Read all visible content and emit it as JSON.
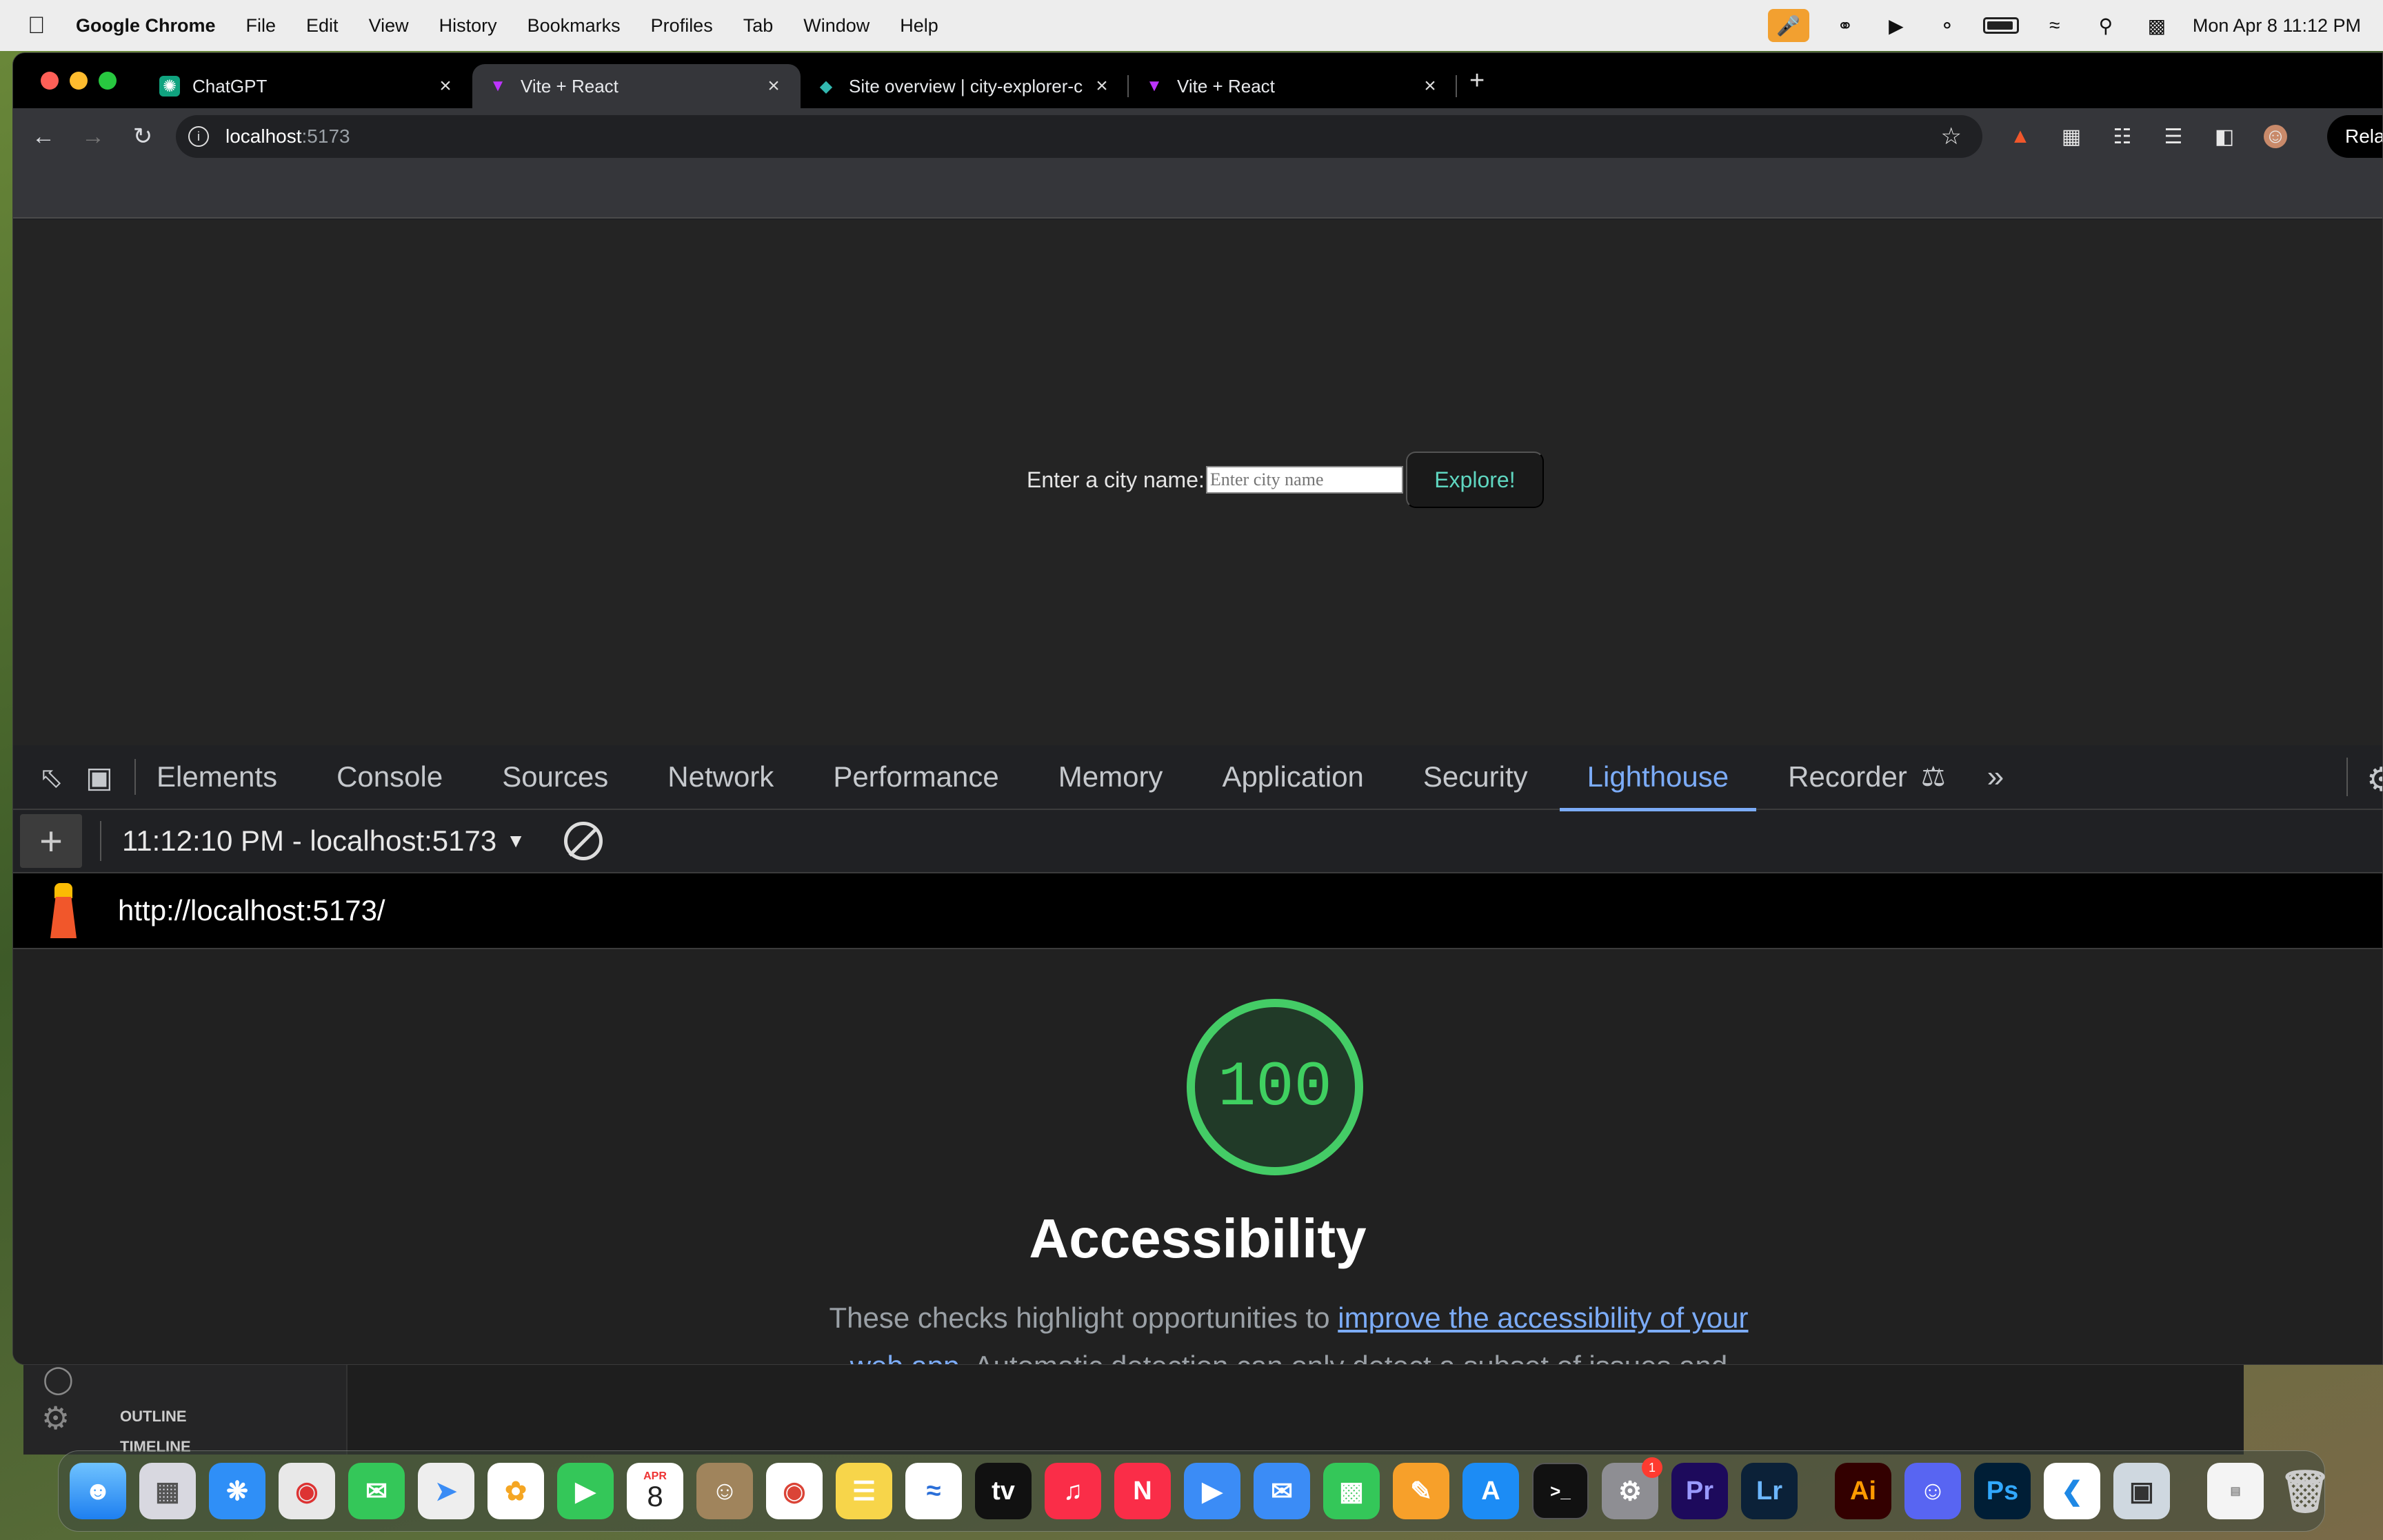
{
  "menubar": {
    "apple": "",
    "app_name": "Google Chrome",
    "items": [
      "File",
      "Edit",
      "View",
      "History",
      "Bookmarks",
      "Profiles",
      "Tab",
      "Window",
      "Help"
    ],
    "clock": "Mon Apr 8  11:12 PM"
  },
  "tabs": [
    {
      "label": "ChatGPT",
      "icon": "chatgpt-icon"
    },
    {
      "label": "Vite + React",
      "icon": "vite-icon"
    },
    {
      "label": "Site overview | city-explorer-c",
      "icon": "netlify-icon"
    },
    {
      "label": "Vite + React",
      "icon": "vite-icon"
    }
  ],
  "omnibox": {
    "host": "localhost",
    "port": ":5173"
  },
  "relaunch_label": "Rela",
  "page": {
    "label": "Enter a city name:",
    "placeholder": "Enter city name",
    "button": "Explore!"
  },
  "devtools": {
    "tabs": [
      "Elements",
      "Console",
      "Sources",
      "Network",
      "Performance",
      "Memory",
      "Application",
      "Security",
      "Lighthouse",
      "Recorder"
    ],
    "active_tab": "Lighthouse",
    "report_selector": "11:12:10 PM - localhost:5173",
    "report_url": "http://localhost:5173/"
  },
  "report": {
    "score": "100",
    "category": "Accessibility",
    "desc_before": "These checks highlight opportunities to ",
    "desc_link": "improve the accessibility of your web app",
    "desc_after": ". Automatic detection can only detect a subset of issues and"
  },
  "vscode": {
    "outline": "OUTLINE",
    "timeline": "TIMELINE"
  },
  "dock": {
    "calendar_month": "APR",
    "calendar_day": "8",
    "settings_badge": "1",
    "pr": "Pr",
    "lr": "Lr",
    "ai": "Ai",
    "ps": "Ps"
  },
  "colors": {
    "accent": "#7cacf8",
    "score_green": "#3fd060",
    "explore_text": "#5fd6c0"
  }
}
